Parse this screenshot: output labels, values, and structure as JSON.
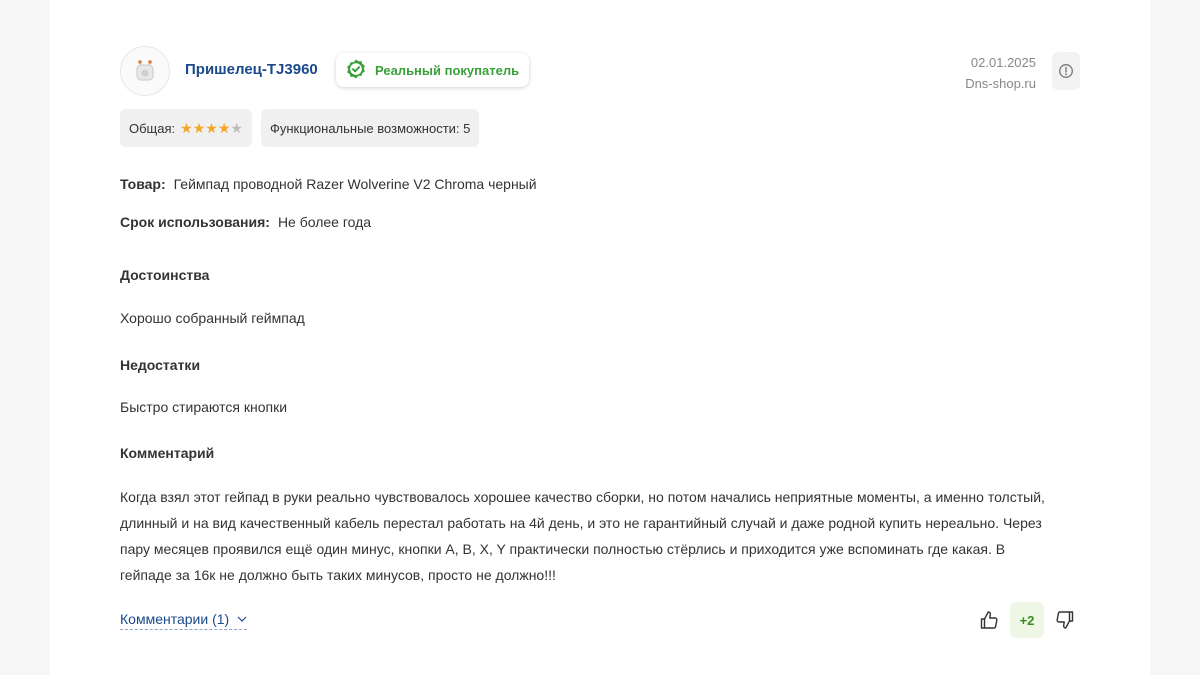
{
  "review": {
    "author": "Пришелец-TJ3960",
    "badge_label": "Реальный покупатель",
    "date": "02.01.2025",
    "source": "Dns-shop.ru",
    "ratings": {
      "overall_label": "Общая:",
      "overall_stars": 4,
      "overall_max": 5,
      "feature_label": "Функциональные возможности: 5"
    },
    "product_label": "Товар:",
    "product_value": "Геймпад проводной Razer Wolverine V2 Chroma черный",
    "usage_label": "Срок использования:",
    "usage_value": "Не более года",
    "pros_title": "Достоинства",
    "pros_text": "Хорошо собранный геймпад",
    "cons_title": "Недостатки",
    "cons_text": "Быстро стираются кнопки",
    "comment_title": "Комментарий",
    "comment_text": "Когда взял этот гейпад в руки реально чувствовалось хорошее качество сборки, но потом начались неприятные моменты, а именно толстый, длинный и на вид качественный кабель перестал работать на 4й день, и это не гарантийный случай и даже родной купить нереально. Через пару месяцев проявился ещё один минус, кнопки A, B, X, Y практически полностью стёрлись и приходится уже вспоминать где какая. В гейпаде за 16к не должно быть таких минусов, просто не должно!!!",
    "comments_link": "Комментарии (1)",
    "vote_count": "+2"
  },
  "icons": {
    "badge": "verified-check-icon",
    "info": "info-icon",
    "chevron": "chevron-down-icon",
    "like": "thumbs-up-icon",
    "dislike": "thumbs-down-icon"
  },
  "colors": {
    "link": "#1a4a8c",
    "verified": "#3aa03a",
    "star": "#f5a623",
    "vote_positive": "#3a8a1f"
  }
}
